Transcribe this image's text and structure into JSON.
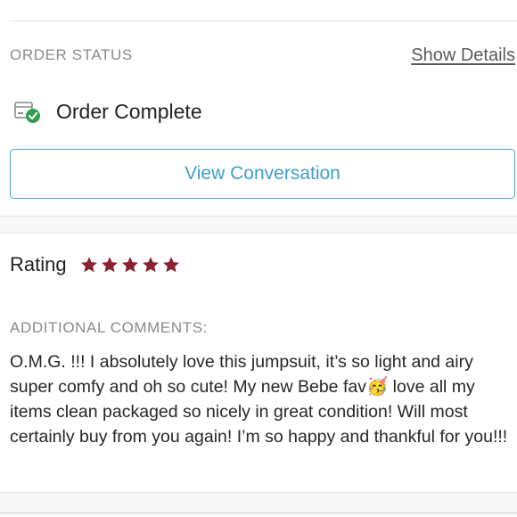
{
  "order_status": {
    "section_label": "ORDER STATUS",
    "show_details_label": "Show Details",
    "status_text": "Order Complete",
    "status_icon": "package-check-icon"
  },
  "actions": {
    "view_conversation_label": "View Conversation"
  },
  "rating": {
    "label": "Rating",
    "stars": 5,
    "max_stars": 5,
    "star_color": "#8b2230"
  },
  "comments": {
    "label": "ADDITIONAL COMMENTS:",
    "text": "O.M.G. !!! I absolutely love this jumpsuit, it’s so light and airy super comfy and oh so cute! My new Bebe fav🥳 love all my items clean packaged so nicely in great condition! Will most certainly buy from you again! I’m so happy and thankful for you!!!"
  },
  "colors": {
    "accent": "#3f9fc8",
    "success": "#2e9e4f"
  }
}
